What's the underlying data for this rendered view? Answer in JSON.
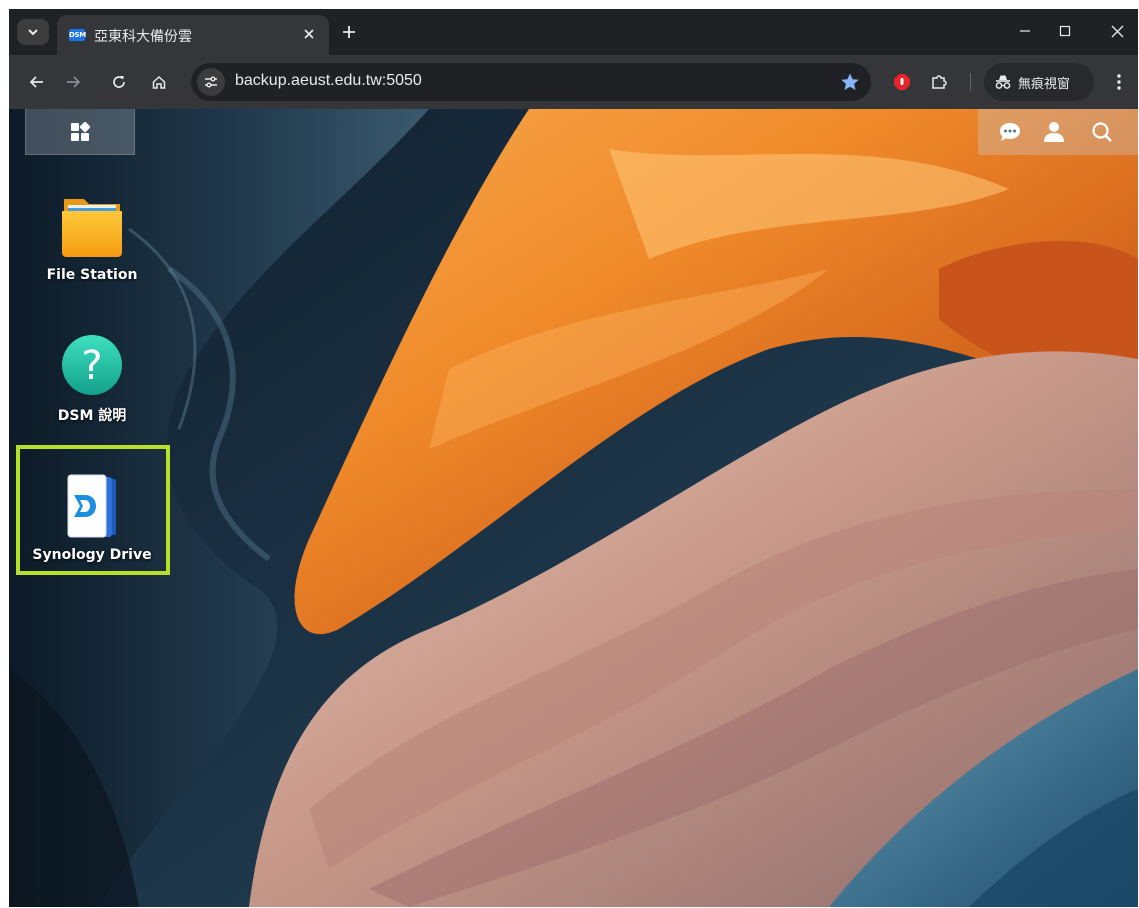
{
  "browser": {
    "tab": {
      "favicon_text": "DSM",
      "title": "亞東科大備份雲"
    },
    "url": "backup.aeust.edu.tw:5050",
    "incognito_label": "無痕視窗",
    "icons": {
      "tab_search": "chevron-down-icon",
      "close_tab": "close-icon",
      "new_tab": "plus-icon",
      "minimize": "minimize-icon",
      "maximize": "maximize-icon",
      "close_window": "close-icon",
      "back": "arrow-left-icon",
      "forward": "arrow-right-icon",
      "reload": "reload-icon",
      "home": "home-icon",
      "site_info": "tune-icon",
      "bookmark": "star-icon",
      "extension_red": "adblock-icon",
      "extensions": "puzzle-icon",
      "incognito": "incognito-icon",
      "menu": "kebab-menu-icon"
    }
  },
  "dsm": {
    "top_right": {
      "icons": [
        "chat-icon",
        "user-icon",
        "search-icon"
      ]
    },
    "desktop_icons": [
      {
        "label": "File Station",
        "icon": "folder-icon"
      },
      {
        "label": "DSM 說明",
        "icon": "help-icon"
      },
      {
        "label": "Synology Drive",
        "icon": "synology-drive-icon"
      }
    ],
    "highlight_color": "#b6e02a"
  }
}
